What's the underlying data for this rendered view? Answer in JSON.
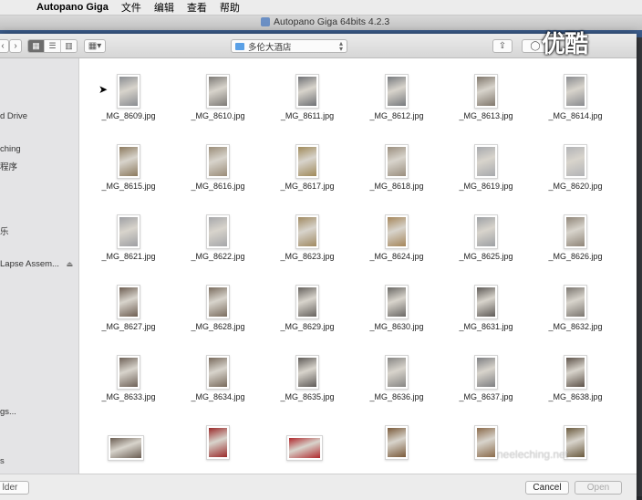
{
  "menubar": {
    "app_name": "Autopano Giga",
    "items": [
      "文件",
      "编辑",
      "查看",
      "帮助"
    ]
  },
  "window": {
    "title": "Autopano Giga 64bits 4.2.3"
  },
  "dialog": {
    "location": "多伦大酒店",
    "sidebar_items": [
      "d Drive",
      "ching",
      "程序",
      "乐",
      "Lapse Assem...",
      "gs...",
      "s",
      "s"
    ],
    "files": [
      {
        "name": "_MG_8609.jpg",
        "color": "#8a8d92"
      },
      {
        "name": "_MG_8610.jpg",
        "color": "#7d7a76"
      },
      {
        "name": "_MG_8611.jpg",
        "color": "#6f7175"
      },
      {
        "name": "_MG_8612.jpg",
        "color": "#777a7e"
      },
      {
        "name": "_MG_8613.jpg",
        "color": "#80776c"
      },
      {
        "name": "_MG_8614.jpg",
        "color": "#8a8c90"
      },
      {
        "name": "_MG_8615.jpg",
        "color": "#8c7a5e"
      },
      {
        "name": "_MG_8616.jpg",
        "color": "#9a8c78"
      },
      {
        "name": "_MG_8617.jpg",
        "color": "#a08a5a"
      },
      {
        "name": "_MG_8618.jpg",
        "color": "#9a8e7e"
      },
      {
        "name": "_MG_8619.jpg",
        "color": "#a7a9ad"
      },
      {
        "name": "_MG_8620.jpg",
        "color": "#b2b3b6"
      },
      {
        "name": "_MG_8621.jpg",
        "color": "#9e9fa3"
      },
      {
        "name": "_MG_8622.jpg",
        "color": "#a6a7aa"
      },
      {
        "name": "_MG_8623.jpg",
        "color": "#a08a62"
      },
      {
        "name": "_MG_8624.jpg",
        "color": "#a5865a"
      },
      {
        "name": "_MG_8625.jpg",
        "color": "#9da0a4"
      },
      {
        "name": "_MG_8626.jpg",
        "color": "#8f8578"
      },
      {
        "name": "_MG_8627.jpg",
        "color": "#6e5e52"
      },
      {
        "name": "_MG_8628.jpg",
        "color": "#7a6c5e"
      },
      {
        "name": "_MG_8629.jpg",
        "color": "#66625e"
      },
      {
        "name": "_MG_8630.jpg",
        "color": "#6a6865"
      },
      {
        "name": "_MG_8631.jpg",
        "color": "#5e5a57"
      },
      {
        "name": "_MG_8632.jpg",
        "color": "#7b7670"
      },
      {
        "name": "_MG_8633.jpg",
        "color": "#6f6258"
      },
      {
        "name": "_MG_8634.jpg",
        "color": "#786a5c"
      },
      {
        "name": "_MG_8635.jpg",
        "color": "#5f5b58"
      },
      {
        "name": "_MG_8636.jpg",
        "color": "#878684"
      },
      {
        "name": "_MG_8637.jpg",
        "color": "#7e7f82"
      },
      {
        "name": "_MG_8638.jpg",
        "color": "#5d5249"
      },
      {
        "name": "",
        "color": "#6a5d52",
        "landscape": true
      },
      {
        "name": "",
        "color": "#9a2a2a"
      },
      {
        "name": "",
        "color": "#b0282c",
        "landscape": true
      },
      {
        "name": "",
        "color": "#7a5a3a"
      },
      {
        "name": "",
        "color": "#8a6a4a"
      },
      {
        "name": "",
        "color": "#6a5a3e"
      }
    ],
    "new_folder_label": "lder",
    "cancel_label": "Cancel",
    "open_label": "Open"
  },
  "watermark": {
    "top": "优酷",
    "bottom": "neeleching.net"
  }
}
